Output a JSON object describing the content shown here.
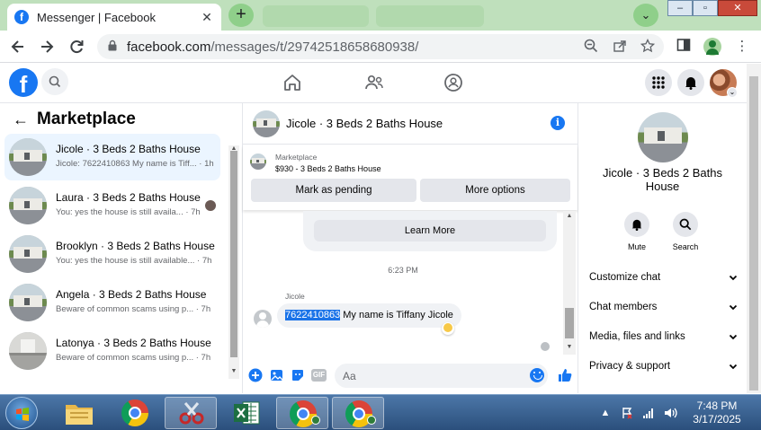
{
  "browser": {
    "tab_title": "Messenger | Facebook",
    "tab_close": "✕",
    "new_tab": "+",
    "url_host": "facebook.com",
    "url_path": "/messages/t/29742518658680938/",
    "window_controls": {
      "minimize": "–",
      "maximize": "▫",
      "close": "✕"
    }
  },
  "facebook": {
    "logo_letter": "f",
    "icons": [
      "search-icon",
      "home-icon",
      "friends-icon",
      "groups-icon",
      "menu-grid-icon",
      "bell-icon",
      "profile-avatar"
    ],
    "brand_color": "#1877f2"
  },
  "sidebar": {
    "back": "←",
    "title": "Marketplace",
    "conversations": [
      {
        "name": "Jicole · 3 Beds 2 Baths House",
        "preview": "Jicole: 7622410863 My name is Tiff... · 1h",
        "active": true
      },
      {
        "name": "Laura · 3 Beds 2 Baths House",
        "preview": "You: yes the house is still availa... · 7h",
        "active": false
      },
      {
        "name": "Brooklyn · 3 Beds 2 Baths House",
        "preview": "You: yes the house is still available... · 7h",
        "active": false
      },
      {
        "name": "Angela · 3 Beds 2 Baths House",
        "preview": "Beware of common scams using p... · 7h",
        "active": false
      },
      {
        "name": "Latonya · 3 Beds 2 Baths House",
        "preview": "Beware of common scams using p... · 7h",
        "active": false
      }
    ]
  },
  "chat": {
    "header_title": "Jicole · 3 Beds 2 Baths House",
    "info": "i",
    "listing": {
      "category": "Marketplace",
      "description": "$930 - 3 Beds 2 Baths House",
      "mark_pending": "Mark as pending",
      "more_options": "More options"
    },
    "learn_more": "Learn More",
    "time": "6:23 PM",
    "sender": "Jicole",
    "message_number": "7622410863",
    "message_text": " My name is Tiffany Jicole",
    "composer_placeholder": "Aa",
    "gif_label": "GIF"
  },
  "details": {
    "title": "Jicole · 3 Beds 2 Baths House",
    "actions": [
      {
        "label": "Mute"
      },
      {
        "label": "Search"
      }
    ],
    "sections": [
      {
        "label": "Customize chat"
      },
      {
        "label": "Chat members"
      },
      {
        "label": "Media, files and links"
      },
      {
        "label": "Privacy & support"
      }
    ],
    "chevron": "⌄"
  },
  "taskbar": {
    "time": "7:48 PM",
    "date": "3/17/2025"
  }
}
